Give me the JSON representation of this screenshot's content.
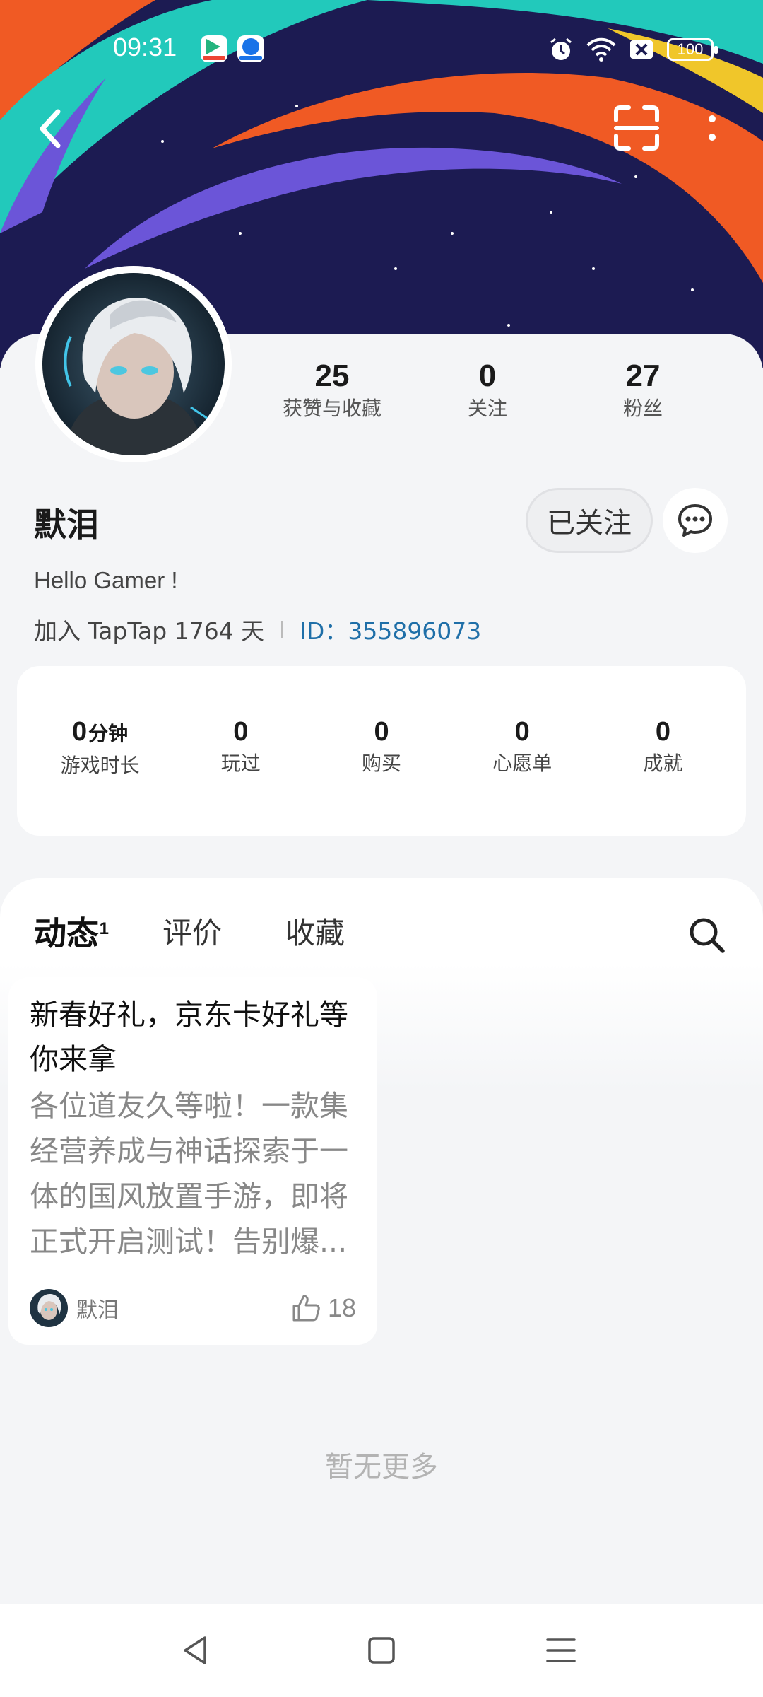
{
  "status_bar": {
    "time": "09:31",
    "battery": "100"
  },
  "profile": {
    "username": "默泪",
    "bio": "Hello Gamer !",
    "join_text": "加入 TapTap 1764 天",
    "id_text": "ID：355896073",
    "follow_label": "已关注",
    "top_stats": [
      {
        "value": "25",
        "label": "获赞与收藏"
      },
      {
        "value": "0",
        "label": "关注"
      },
      {
        "value": "27",
        "label": "粉丝"
      }
    ]
  },
  "game_stats": {
    "playtime_value": "0",
    "playtime_unit": "分钟",
    "playtime_label": "游戏时长",
    "items": [
      {
        "value": "0",
        "label": "玩过"
      },
      {
        "value": "0",
        "label": "购买"
      },
      {
        "value": "0",
        "label": "心愿单"
      },
      {
        "value": "0",
        "label": "成就"
      }
    ]
  },
  "tabs": [
    {
      "label": "动态",
      "badge": "1"
    },
    {
      "label": "评价"
    },
    {
      "label": "收藏"
    }
  ],
  "post": {
    "title": "新春好礼，京东卡好礼等你来拿",
    "body": "各位道友久等啦！一款集经营养成与神话探索于一体的国风放置手游，即将正式开启测试！告别爆...",
    "author": "默泪",
    "likes": "18"
  },
  "no_more_text": "暂无更多",
  "colors": {
    "accent": "#14c9c9",
    "id_link": "#1f6fa8",
    "banner_bg": "#1c1b52"
  }
}
